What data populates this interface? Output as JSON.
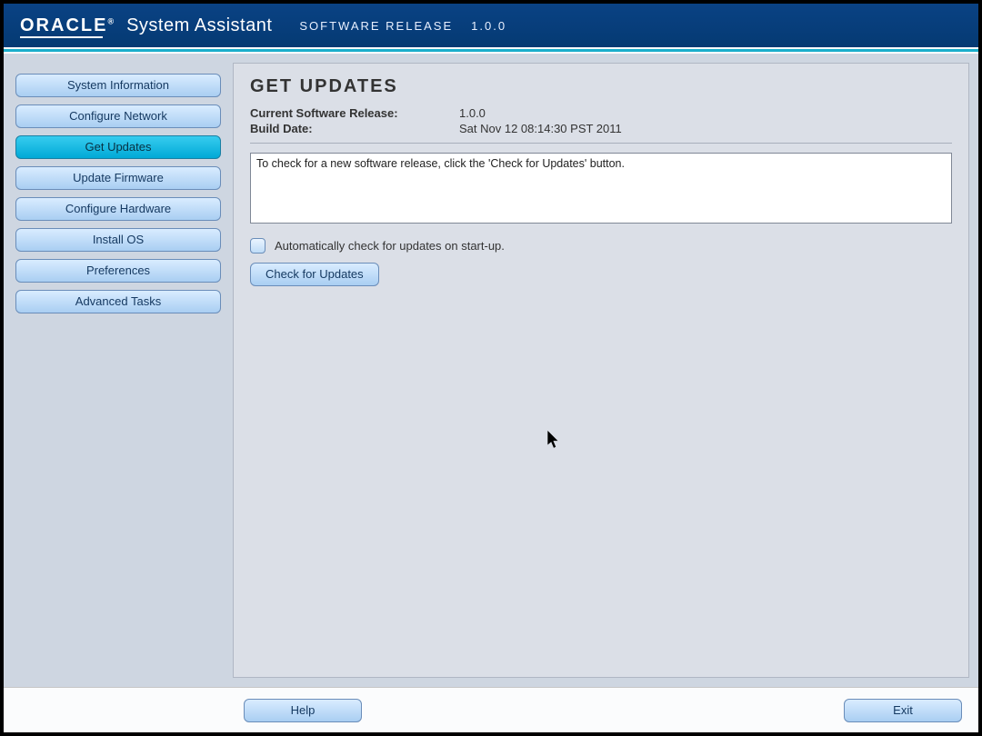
{
  "header": {
    "brand": "ORACLE",
    "tm": "®",
    "product": "System Assistant",
    "release_label": "SOFTWARE RELEASE",
    "release_version": "1.0.0"
  },
  "sidebar": {
    "items": [
      {
        "label": "System Information",
        "name": "sidebar-item-system-information",
        "active": false
      },
      {
        "label": "Configure Network",
        "name": "sidebar-item-configure-network",
        "active": false
      },
      {
        "label": "Get Updates",
        "name": "sidebar-item-get-updates",
        "active": true
      },
      {
        "label": "Update Firmware",
        "name": "sidebar-item-update-firmware",
        "active": false
      },
      {
        "label": "Configure Hardware",
        "name": "sidebar-item-configure-hardware",
        "active": false
      },
      {
        "label": "Install OS",
        "name": "sidebar-item-install-os",
        "active": false
      },
      {
        "label": "Preferences",
        "name": "sidebar-item-preferences",
        "active": false
      },
      {
        "label": "Advanced Tasks",
        "name": "sidebar-item-advanced-tasks",
        "active": false
      }
    ]
  },
  "main": {
    "title": "GET UPDATES",
    "current_release_label": "Current Software Release:",
    "current_release_value": "1.0.0",
    "build_date_label": "Build Date:",
    "build_date_value": "Sat Nov 12 08:14:30 PST 2011",
    "message": "To check for a new software release, click the 'Check for Updates' button.",
    "auto_check_label": "Automatically check for updates on start-up.",
    "auto_check_checked": false,
    "check_button_label": "Check for Updates"
  },
  "footer": {
    "help_label": "Help",
    "exit_label": "Exit"
  },
  "colors": {
    "header_bg": "#0b3d7a",
    "accent": "#1aaecb",
    "button_light": "#d9ecff",
    "button_dark": "#a9cef2",
    "button_active_light": "#37ccef",
    "button_active_dark": "#00a9d6",
    "page_bg": "#ced6e1",
    "panel_bg": "#dbdfe7"
  }
}
